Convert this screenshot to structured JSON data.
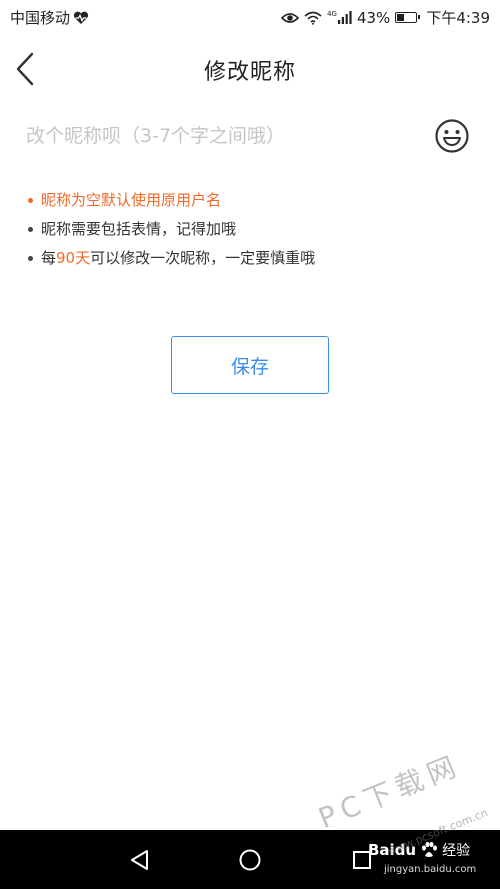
{
  "status_bar": {
    "carrier": "中国移动",
    "network": "4G",
    "battery_percent": "43%",
    "battery_level": 0.43,
    "time": "下午4:39"
  },
  "header": {
    "title": "修改昵称"
  },
  "nickname": {
    "value": "",
    "placeholder": "改个昵称呗（3-7个字之间哦）"
  },
  "tips": [
    {
      "text": "昵称为空默认使用原用户名"
    },
    {
      "text": "昵称需要包括表情，记得加哦"
    },
    {
      "prefix": "每",
      "highlight": "90天",
      "suffix": "可以修改一次昵称，一定要慎重哦"
    }
  ],
  "save_button": {
    "label": "保存"
  },
  "colors": {
    "accent_blue": "#3b8ee8",
    "warning_orange": "#f26a2a",
    "placeholder_gray": "#c6c6c6"
  },
  "watermarks": {
    "site": "PC下载网",
    "site_url": "www.pcsoft.com.cn",
    "baidu_brand": "Baidu",
    "baidu_product": "经验",
    "baidu_url": "jingyan.baidu.com"
  }
}
